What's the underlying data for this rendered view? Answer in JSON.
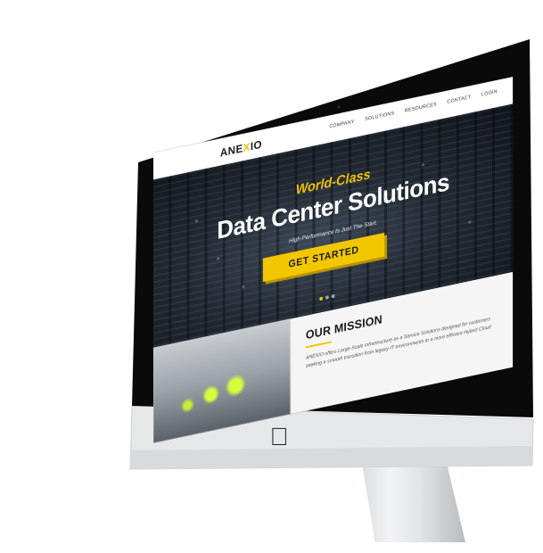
{
  "nav": {
    "logo_prefix": "ANE",
    "logo_x": "X",
    "logo_suffix": "IO",
    "items": [
      "COMPANY",
      "SOLUTIONS",
      "RESOURCES",
      "CONTACT",
      "LOGIN"
    ]
  },
  "hero": {
    "eyebrow": "World-Class",
    "title": "Data Center Solutions",
    "subtitle": "High Performance Is Just The Start.",
    "cta_label": "GET STARTED",
    "slides": 3,
    "active_slide": 1
  },
  "mission": {
    "title": "OUR MISSION",
    "text": "ANEXIO offers Large-Scale Infrastructure as a Service Solutions designed for customers seeking a smooth transition from legacy IT environments to a more efficient Hybrid Cloud"
  },
  "device": {
    "logo_icon": "apple-logo-icon"
  },
  "colors": {
    "accent": "#f2c700",
    "bezel": "#0b0b0b",
    "chin": "#e9eaec"
  }
}
